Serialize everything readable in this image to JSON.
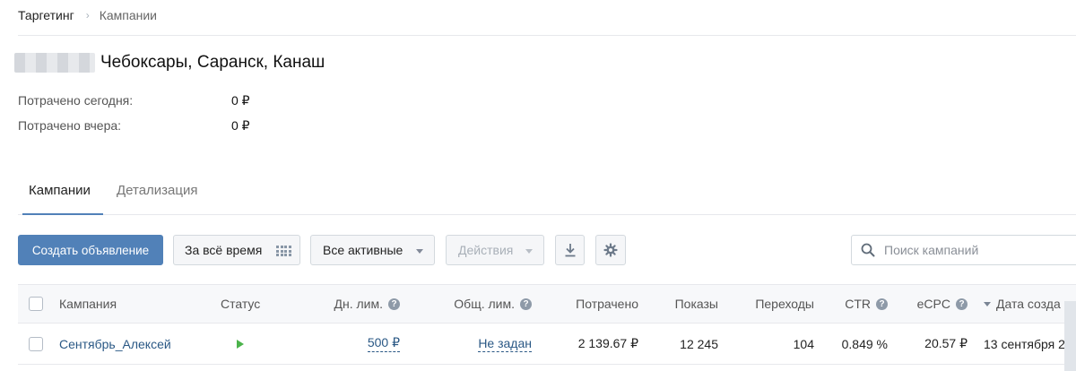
{
  "breadcrumb": {
    "root": "Таргетинг",
    "separator": "›",
    "current": "Кампании"
  },
  "account": {
    "name": "Чебоксары, Саранск, Канаш"
  },
  "stats": [
    {
      "label": "Потрачено сегодня:",
      "value": "0 ₽"
    },
    {
      "label": "Потрачено вчера:",
      "value": "0 ₽"
    }
  ],
  "tabs": [
    {
      "label": "Кампании",
      "active": true
    },
    {
      "label": "Детализация",
      "active": false
    }
  ],
  "toolbar": {
    "create_label": "Создать объявление",
    "period_label": "За всё время",
    "filter_label": "Все активные",
    "actions_label": "Действия"
  },
  "search": {
    "placeholder": "Поиск кампаний",
    "value": ""
  },
  "table": {
    "headers": {
      "campaign": "Кампания",
      "status": "Статус",
      "daily_limit": "Дн. лим.",
      "total_limit": "Общ. лим.",
      "spent": "Потрачено",
      "impressions": "Показы",
      "clicks": "Переходы",
      "ctr": "CTR",
      "ecpc": "eCPC",
      "created": "Дата созда"
    },
    "rows": [
      {
        "campaign": "Сентябрь_Алексей",
        "status": "active",
        "daily_limit": "500 ₽",
        "total_limit": "Не задан",
        "spent": "2 139.67 ₽",
        "impressions": "12 245",
        "clicks": "104",
        "ctr": "0.849 %",
        "ecpc": "20.57 ₽",
        "created": "13 сентября 2"
      }
    ]
  },
  "colors": {
    "accent": "#5181b8",
    "link": "#2a5885",
    "status_active": "#4bb34b"
  },
  "icons": {
    "breadcrumb_separator": "chevron-right-icon",
    "period": "calendar-grid-icon",
    "dropdown": "caret-down-icon",
    "download": "download-icon",
    "settings": "gear-icon",
    "search": "search-icon",
    "help": "help-icon",
    "status": "play-icon",
    "sort": "sort-desc-icon"
  }
}
